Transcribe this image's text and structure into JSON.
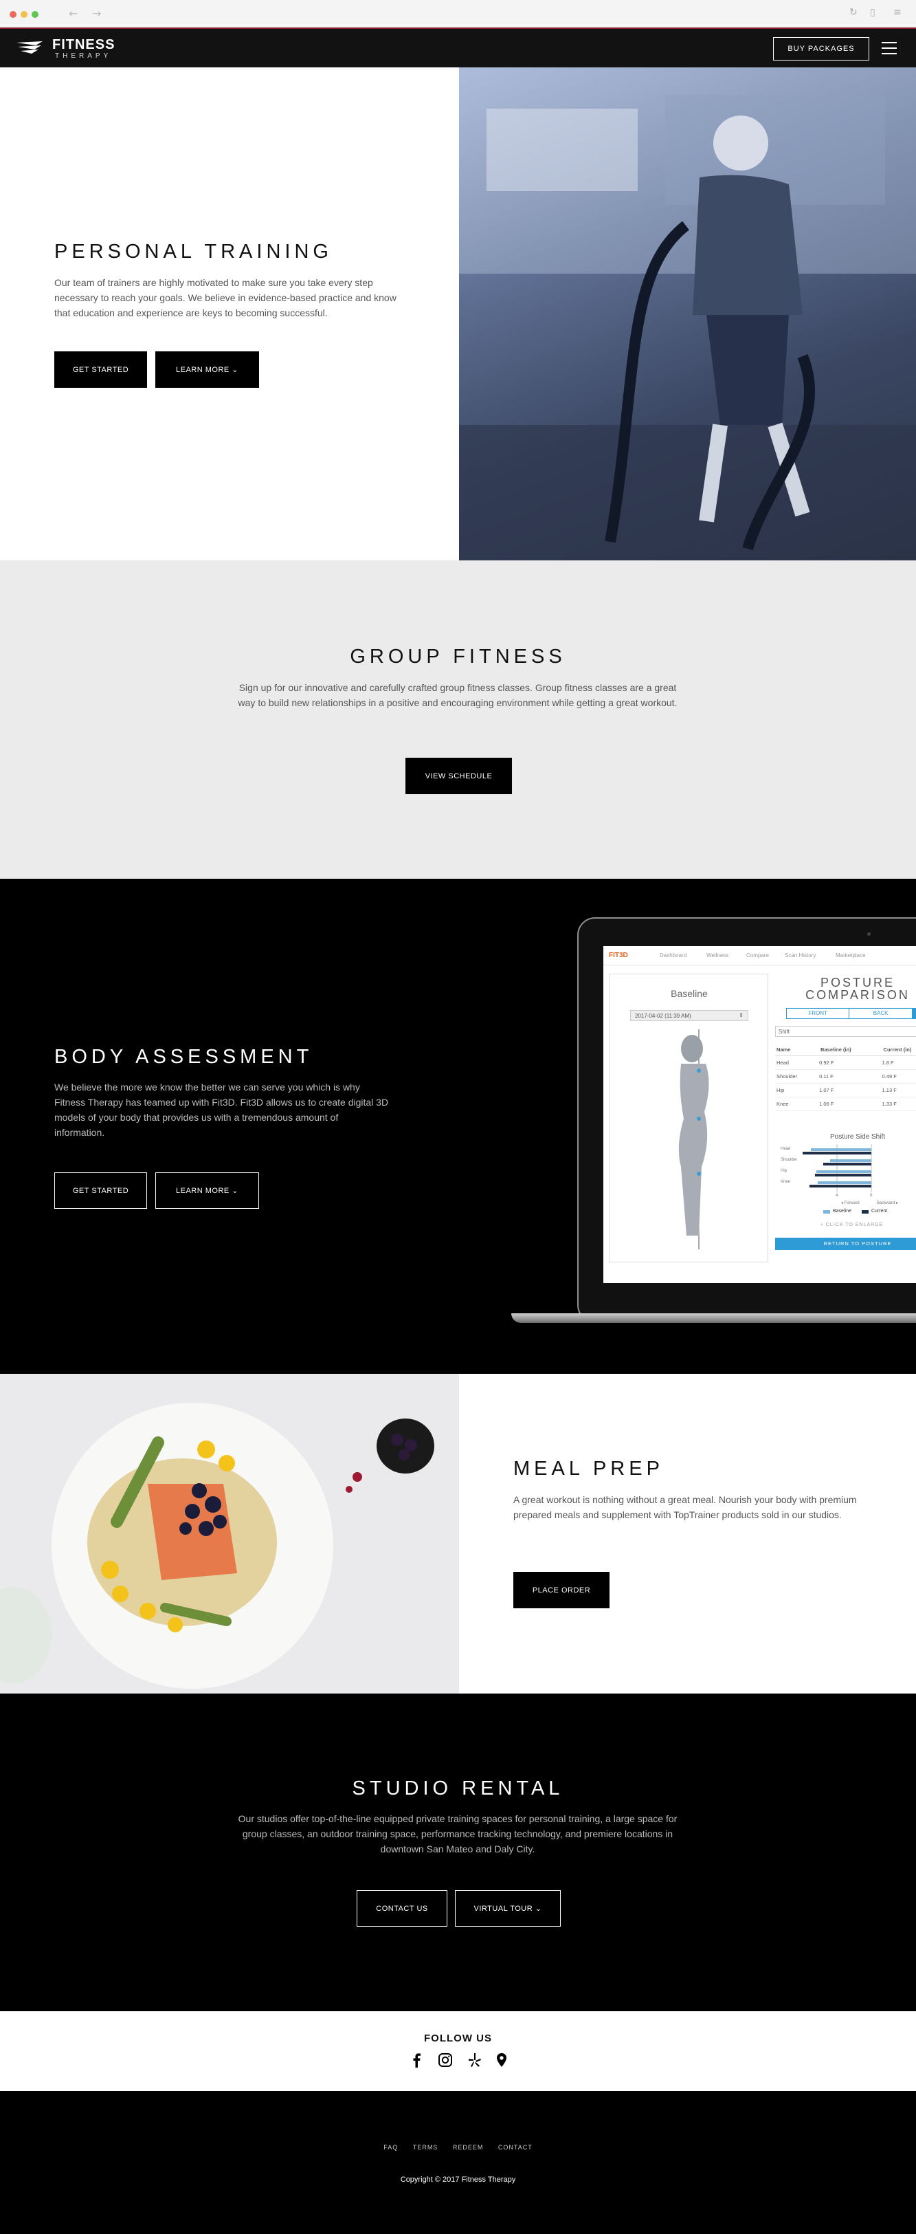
{
  "brand": {
    "name": "FITNESS",
    "tagline": "THERAPY",
    "accent": "#8a1c2b"
  },
  "header": {
    "buy_label": "BUY PACKAGES",
    "menu_icon": "hamburger-icon"
  },
  "personal_training": {
    "title": "PERSONAL TRAINING",
    "body": "Our team of trainers are highly motivated to make sure you take every step necessary to reach your goals. We believe in evidence-based practice and know that education and experience are keys to becoming successful.",
    "get_started": "GET STARTED",
    "learn_more": "LEARN MORE ⌄"
  },
  "group_fitness": {
    "title": "GROUP FITNESS",
    "body": "Sign up for our innovative and carefully crafted group fitness classes. Group fitness classes are a great way to build new relationships in a positive and encouraging environment while getting a great workout.",
    "schedule_label": "VIEW SCHEDULE"
  },
  "body_assessment": {
    "title": "BODY ASSESSMENT",
    "body": "We believe the more we know the better we can serve you which is why Fitness Therapy has teamed up with Fit3D. Fit3D allows us to create digital 3D models of your body that provides us with a tremendous amount of information.",
    "get_started": "GET STARTED",
    "learn_more": "LEARN MORE ⌄",
    "screen": {
      "logo": "FIT3D",
      "nav": [
        "Dashboard",
        "Wellness",
        "Compare",
        "Scan History",
        "Marketplace"
      ],
      "baseline": "Baseline",
      "date": "2017-04-02 (11:39 AM)",
      "title_1": "POSTURE",
      "title_2": "COMPARISON",
      "tabs": [
        "FRONT",
        "BACK",
        "S"
      ],
      "shift_label": "Shift",
      "columns": [
        "Name",
        "Baseline (in)",
        "Current (in)"
      ],
      "rows": [
        [
          "Head",
          "0.92 F",
          "1.8 F"
        ],
        [
          "Shoulder",
          "0.11 F",
          "0.49 F"
        ],
        [
          "Hip",
          "1.07 F",
          "1.13 F"
        ],
        [
          "Knee",
          "1.06 F",
          "1.33 F"
        ]
      ],
      "chart_title": "Posture Side Shift",
      "chart_labels": [
        "Head",
        "Shoulder",
        "Hip",
        "Knee"
      ],
      "axis_labels": [
        "4",
        "0"
      ],
      "direction_labels": [
        "◂ Forward",
        "Backward ▸"
      ],
      "legend": [
        "Baseline",
        "Current"
      ],
      "enlarge": "CLICK TO ENLARGE",
      "return_btn": "RETURN TO POSTURE"
    }
  },
  "meal_prep": {
    "title": "MEAL PREP",
    "body": "A great workout is nothing without a great meal. Nourish your body with premium prepared meals and supplement with TopTrainer products sold in our studios.",
    "order_label": "PLACE ORDER"
  },
  "studio_rental": {
    "title": "STUDIO RENTAL",
    "body": "Our studios offer top-of-the-line equipped private training spaces for personal training, a large space for group classes, an outdoor training space, performance tracking technology, and premiere locations in downtown San Mateo and Daly City.",
    "contact_label": "CONTACT US",
    "tour_label": "VIRTUAL TOUR ⌄"
  },
  "follow": {
    "title": "FOLLOW US",
    "icons": [
      "facebook-icon",
      "instagram-icon",
      "yelp-icon",
      "location-icon"
    ]
  },
  "footer": {
    "links": [
      "FAQ",
      "TERMS",
      "REDEEM",
      "CONTACT"
    ],
    "copyright": "Copyright © 2017 Fitness Therapy"
  }
}
